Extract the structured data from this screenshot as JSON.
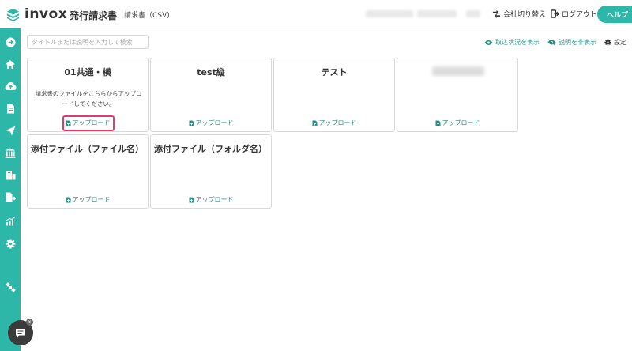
{
  "header": {
    "logo_text": "invox",
    "logo_sub": "発行請求書",
    "page_subtitle": "請求書（CSV)",
    "switch_company": "会社切り替え",
    "logout": "ログアウト",
    "help": "ヘルプ"
  },
  "toolbar": {
    "search_placeholder": "タイトルまたは説明を入力して検索",
    "show_status": "取込状況を表示",
    "hide_description": "説明を非表示",
    "settings": "設定"
  },
  "cards": [
    {
      "title": "01共通・横",
      "description": "請求書のファイルをこちらからアップロードしてください。",
      "upload_label": "アップロード"
    },
    {
      "title": "test縦",
      "upload_label": "アップロード"
    },
    {
      "title": "テスト",
      "upload_label": "アップロード"
    },
    {
      "upload_label": "アップロード"
    },
    {
      "title": "添付ファイル（ファイル名）",
      "upload_label": "アップロード"
    },
    {
      "title": "添付ファイル（フォルダ名）",
      "upload_label": "アップロード"
    }
  ],
  "colors": {
    "accent": "#2db7a8",
    "link": "#2a8f84",
    "highlight": "#e23a6a"
  },
  "sidebar_icons": [
    "arrow-right-circle-icon",
    "home-icon",
    "cloud-upload-icon",
    "document-icon",
    "send-icon",
    "bank-icon",
    "building-icon",
    "export-file-icon",
    "chart-icon",
    "gear-icon",
    "satellite-icon"
  ]
}
